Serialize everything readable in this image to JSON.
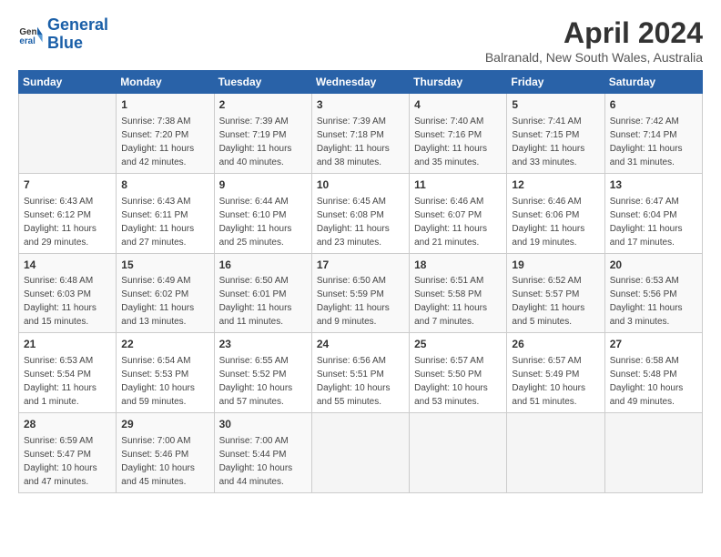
{
  "logo": {
    "line1": "General",
    "line2": "Blue"
  },
  "title": "April 2024",
  "subtitle": "Balranald, New South Wales, Australia",
  "days_of_week": [
    "Sunday",
    "Monday",
    "Tuesday",
    "Wednesday",
    "Thursday",
    "Friday",
    "Saturday"
  ],
  "weeks": [
    [
      {
        "day": "",
        "info": ""
      },
      {
        "day": "1",
        "info": "Sunrise: 7:38 AM\nSunset: 7:20 PM\nDaylight: 11 hours\nand 42 minutes."
      },
      {
        "day": "2",
        "info": "Sunrise: 7:39 AM\nSunset: 7:19 PM\nDaylight: 11 hours\nand 40 minutes."
      },
      {
        "day": "3",
        "info": "Sunrise: 7:39 AM\nSunset: 7:18 PM\nDaylight: 11 hours\nand 38 minutes."
      },
      {
        "day": "4",
        "info": "Sunrise: 7:40 AM\nSunset: 7:16 PM\nDaylight: 11 hours\nand 35 minutes."
      },
      {
        "day": "5",
        "info": "Sunrise: 7:41 AM\nSunset: 7:15 PM\nDaylight: 11 hours\nand 33 minutes."
      },
      {
        "day": "6",
        "info": "Sunrise: 7:42 AM\nSunset: 7:14 PM\nDaylight: 11 hours\nand 31 minutes."
      }
    ],
    [
      {
        "day": "7",
        "info": "Sunrise: 6:43 AM\nSunset: 6:12 PM\nDaylight: 11 hours\nand 29 minutes."
      },
      {
        "day": "8",
        "info": "Sunrise: 6:43 AM\nSunset: 6:11 PM\nDaylight: 11 hours\nand 27 minutes."
      },
      {
        "day": "9",
        "info": "Sunrise: 6:44 AM\nSunset: 6:10 PM\nDaylight: 11 hours\nand 25 minutes."
      },
      {
        "day": "10",
        "info": "Sunrise: 6:45 AM\nSunset: 6:08 PM\nDaylight: 11 hours\nand 23 minutes."
      },
      {
        "day": "11",
        "info": "Sunrise: 6:46 AM\nSunset: 6:07 PM\nDaylight: 11 hours\nand 21 minutes."
      },
      {
        "day": "12",
        "info": "Sunrise: 6:46 AM\nSunset: 6:06 PM\nDaylight: 11 hours\nand 19 minutes."
      },
      {
        "day": "13",
        "info": "Sunrise: 6:47 AM\nSunset: 6:04 PM\nDaylight: 11 hours\nand 17 minutes."
      }
    ],
    [
      {
        "day": "14",
        "info": "Sunrise: 6:48 AM\nSunset: 6:03 PM\nDaylight: 11 hours\nand 15 minutes."
      },
      {
        "day": "15",
        "info": "Sunrise: 6:49 AM\nSunset: 6:02 PM\nDaylight: 11 hours\nand 13 minutes."
      },
      {
        "day": "16",
        "info": "Sunrise: 6:50 AM\nSunset: 6:01 PM\nDaylight: 11 hours\nand 11 minutes."
      },
      {
        "day": "17",
        "info": "Sunrise: 6:50 AM\nSunset: 5:59 PM\nDaylight: 11 hours\nand 9 minutes."
      },
      {
        "day": "18",
        "info": "Sunrise: 6:51 AM\nSunset: 5:58 PM\nDaylight: 11 hours\nand 7 minutes."
      },
      {
        "day": "19",
        "info": "Sunrise: 6:52 AM\nSunset: 5:57 PM\nDaylight: 11 hours\nand 5 minutes."
      },
      {
        "day": "20",
        "info": "Sunrise: 6:53 AM\nSunset: 5:56 PM\nDaylight: 11 hours\nand 3 minutes."
      }
    ],
    [
      {
        "day": "21",
        "info": "Sunrise: 6:53 AM\nSunset: 5:54 PM\nDaylight: 11 hours\nand 1 minute."
      },
      {
        "day": "22",
        "info": "Sunrise: 6:54 AM\nSunset: 5:53 PM\nDaylight: 10 hours\nand 59 minutes."
      },
      {
        "day": "23",
        "info": "Sunrise: 6:55 AM\nSunset: 5:52 PM\nDaylight: 10 hours\nand 57 minutes."
      },
      {
        "day": "24",
        "info": "Sunrise: 6:56 AM\nSunset: 5:51 PM\nDaylight: 10 hours\nand 55 minutes."
      },
      {
        "day": "25",
        "info": "Sunrise: 6:57 AM\nSunset: 5:50 PM\nDaylight: 10 hours\nand 53 minutes."
      },
      {
        "day": "26",
        "info": "Sunrise: 6:57 AM\nSunset: 5:49 PM\nDaylight: 10 hours\nand 51 minutes."
      },
      {
        "day": "27",
        "info": "Sunrise: 6:58 AM\nSunset: 5:48 PM\nDaylight: 10 hours\nand 49 minutes."
      }
    ],
    [
      {
        "day": "28",
        "info": "Sunrise: 6:59 AM\nSunset: 5:47 PM\nDaylight: 10 hours\nand 47 minutes."
      },
      {
        "day": "29",
        "info": "Sunrise: 7:00 AM\nSunset: 5:46 PM\nDaylight: 10 hours\nand 45 minutes."
      },
      {
        "day": "30",
        "info": "Sunrise: 7:00 AM\nSunset: 5:44 PM\nDaylight: 10 hours\nand 44 minutes."
      },
      {
        "day": "",
        "info": ""
      },
      {
        "day": "",
        "info": ""
      },
      {
        "day": "",
        "info": ""
      },
      {
        "day": "",
        "info": ""
      }
    ]
  ]
}
